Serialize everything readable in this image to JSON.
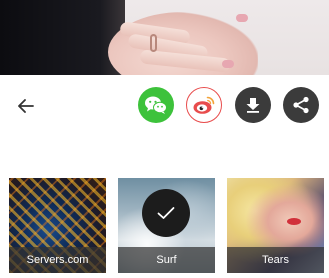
{
  "preview": {
    "image_desc": "hand-photo"
  },
  "toolbar": {
    "back_icon": "arrow-left-icon",
    "share_targets": [
      {
        "icon": "wechat-icon",
        "color": "#3dc23b"
      },
      {
        "icon": "weibo-icon",
        "color": "#e84c4c"
      },
      {
        "icon": "download-icon",
        "color": "#3b3b3b"
      },
      {
        "icon": "share-icon",
        "color": "#3b3b3b"
      }
    ]
  },
  "filters": {
    "items": [
      {
        "label": "Servers.com",
        "selected": false
      },
      {
        "label": "Surf",
        "selected": true
      },
      {
        "label": "Tears",
        "selected": false
      }
    ],
    "selected_icon": "checkmark-icon"
  }
}
